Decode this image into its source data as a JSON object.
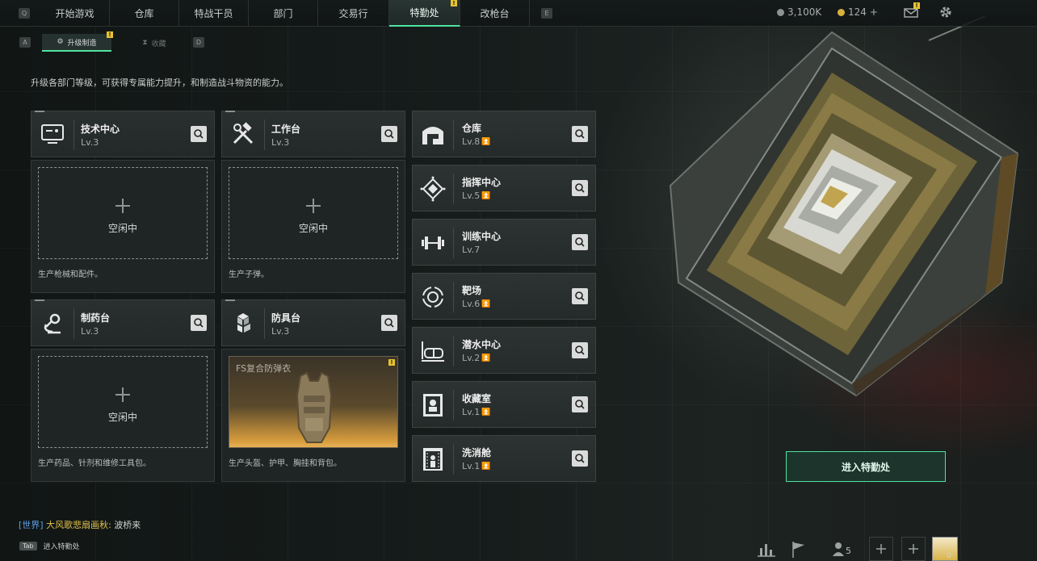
{
  "nav": {
    "left_key": "Q",
    "right_key": "E",
    "tabs": [
      {
        "label": "开始游戏"
      },
      {
        "label": "仓库"
      },
      {
        "label": "特战干员"
      },
      {
        "label": "部门"
      },
      {
        "label": "交易行"
      },
      {
        "label": "特勤处",
        "active": true,
        "badge": "!"
      },
      {
        "label": "改枪台"
      }
    ],
    "currency_a": "3,100K",
    "currency_b": "124",
    "currency_b_add": "+",
    "mail_badge": "!"
  },
  "subnav": {
    "left_key": "A",
    "right_key": "D",
    "tabs": [
      {
        "label": "升级制造",
        "active": true,
        "badge": "!"
      },
      {
        "label": "收藏",
        "active": false
      }
    ]
  },
  "description": "升级各部门等级，可获得专属能力提升，和制造战斗物资的能力。",
  "facilities": [
    {
      "name": "技术中心",
      "level": "Lv.3",
      "icon": "monitor-icon",
      "status": "空闲中",
      "note": "生产枪械和配件。"
    },
    {
      "name": "工作台",
      "level": "Lv.3",
      "icon": "tools-icon",
      "status": "空闲中",
      "note": "生产子弹。"
    },
    {
      "name": "制药台",
      "level": "Lv.3",
      "icon": "microscope-icon",
      "status": "空闲中",
      "note": "生产药品、针剂和维修工具包。"
    },
    {
      "name": "防具台",
      "level": "Lv.3",
      "icon": "armor-cubes-icon",
      "item_name": "FS复合防弹衣",
      "item_badge": "!",
      "note": "生产头盔、护甲、胸挂和背包。"
    }
  ],
  "departments": [
    {
      "name": "仓库",
      "level": "Lv.8",
      "upgradable": true,
      "icon": "warehouse-icon"
    },
    {
      "name": "指挥中心",
      "level": "Lv.5",
      "upgradable": true,
      "icon": "command-icon"
    },
    {
      "name": "训练中心",
      "level": "Lv.7",
      "upgradable": false,
      "icon": "dumbbell-icon"
    },
    {
      "name": "靶场",
      "level": "Lv.6",
      "upgradable": true,
      "icon": "target-icon"
    },
    {
      "name": "潜水中心",
      "level": "Lv.2",
      "upgradable": true,
      "icon": "diving-mask-icon"
    },
    {
      "name": "收藏室",
      "level": "Lv.1",
      "upgradable": true,
      "icon": "bust-icon"
    },
    {
      "name": "洗消舱",
      "level": "Lv.1",
      "upgradable": true,
      "icon": "decon-icon"
    }
  ],
  "enter_button": "进入特勤处",
  "chat": {
    "channel": "[世界]",
    "sender": "大风歌悲扇画秋:",
    "message": "波桥来"
  },
  "tab_hint": {
    "key": "Tab",
    "label": "进入特勤处"
  },
  "friends_count": "5",
  "avatar_level": "0",
  "colors": {
    "accent": "#4fe3a1",
    "badge": "#e8c230",
    "card": "#2a2f2f"
  }
}
